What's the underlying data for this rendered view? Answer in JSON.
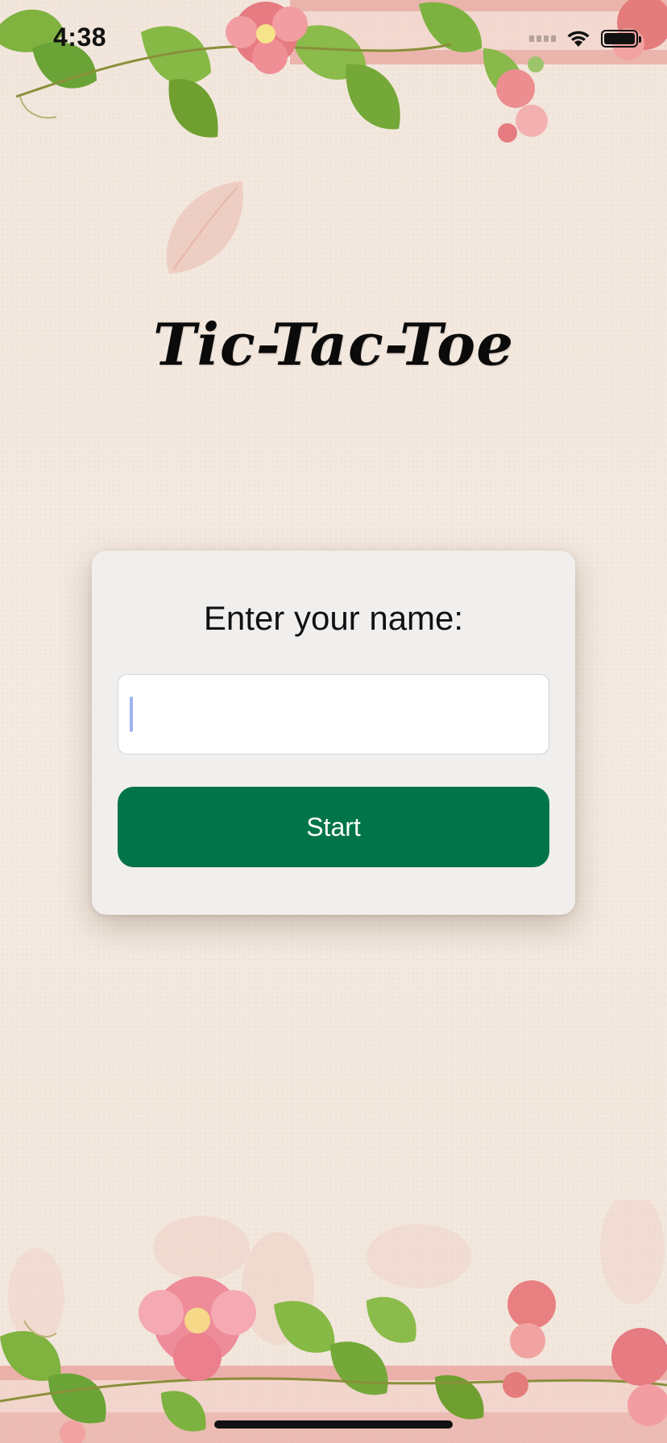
{
  "status_bar": {
    "time": "4:38",
    "icons": [
      "signal-icon",
      "wifi-icon",
      "battery-icon"
    ]
  },
  "screen": {
    "title": "Tic-Tac-Toe"
  },
  "name_card": {
    "prompt": "Enter your name:",
    "input_value": "",
    "input_placeholder": "",
    "start_label": "Start"
  },
  "colors": {
    "background": "#f3e8de",
    "card": "#f1efed",
    "start_button": "#02744a",
    "caret": "#9fb3f2"
  },
  "decorations": [
    "floral-border-top",
    "floral-border-bottom",
    "falling-petal"
  ]
}
